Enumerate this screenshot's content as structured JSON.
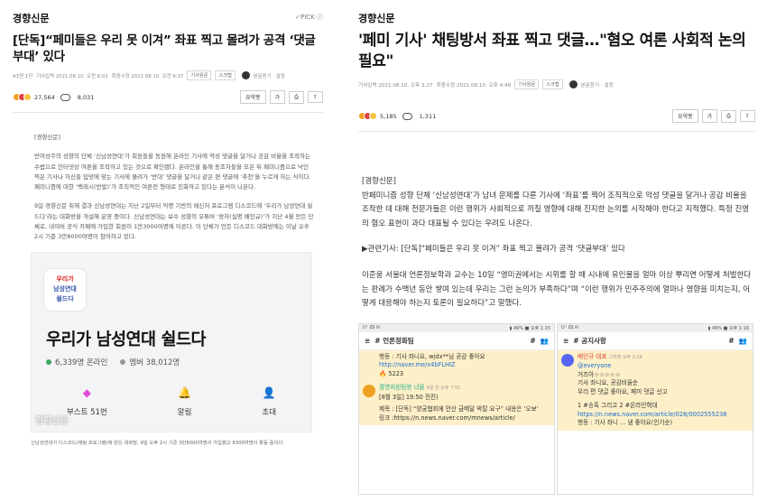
{
  "left": {
    "brand": "경향신문",
    "pick": "✓PICK ⓘ",
    "title": "[단독]“페미들은 우리 못 이겨” 좌표 찍고 몰려가 공격 ‘댓글부대’ 있다",
    "meta": {
      "page": "A1면 1단",
      "published": "기사입력 2021.08.10. 오전 6:01",
      "modified": "최종수정 2021.08.10. 오전 9:37",
      "chip1": "기사원문",
      "chip2": "스크랩",
      "audio": "본문듣기 · 설정"
    },
    "reactions": {
      "likes": "27,564",
      "comments": "8,031"
    },
    "tools": {
      "summary": "요약봇",
      "font": "가"
    },
    "body": [
      "[경향신문]",
      "반여성주의 성향의 단체 ‘신남성연대’가 회원들을 동원해 온라인 기사에 악성 댓글을 달거나 공감 비율을 조작하는 수법으로 인터넷상 여론을 조작하고 있는 것으로 확인됐다. 온라인을 통해 동조자들을 모은 뒤 페미니즘으로 낙인 찍은 기사나 자신들 입맛에 맞는 기사에 몰려가 ‘반대’ 댓글을 달거나 같은 편 댓글에 ‘추천’을 누르게 하는 식이다. 페미니즘에 대한 ‘백래시(반발)’가 조직적인 여론전 형태로 진화하고 있다는 분석이 나온다.",
      "9일 경향신문 취재 결과 신남성연대는 지난 2일부터 익명 기반의 메신저 프로그램 디스코드에 ‘우리가 남성연대 쉴드다’라는 대화방을 개설해 운영 중이다. 신남성연대는 보수 성향의 유튜버 ‘왕자(실명 배인규)’가 지난 4월 만든 단체로, 네이버 공식 카페에 가입한 회원이 1만3000여명에 이른다. 이 단체가 만든 디스코드 대화방에는 이날 오후 2시 기준 3만8000여명이 참여하고 있다."
    ],
    "card": {
      "logo_top": "우리가",
      "logo_mid": "남성연대",
      "logo_bot": "쉴드다",
      "name": "우리가 남성연대 쉴드다",
      "online": "6,339명 온라인",
      "members": "멤버 38,012명",
      "boost": "부스트 51번",
      "alarm": "알림",
      "invite": "초대",
      "watermark": "경향신문"
    },
    "caption": "신남성연대가 디스코드(채팅 프로그램)에 만든 대화방. 9일 오후 2시 기준 3만8000여명이 가입했고 6300여명이 활동 중이다."
  },
  "right": {
    "brand": "경향신문",
    "title": "'페미 기사' 채팅방서 좌표 찍고 댓글…\"혐오 여론 사회적 논의 필요\"",
    "meta": {
      "published": "기사입력 2021.08.10. 오후 3:27",
      "modified": "최종수정 2021.08.10. 오후 4:46",
      "chip1": "기사원문",
      "chip2": "스크랩",
      "audio": "본문듣기 · 설정"
    },
    "reactions": {
      "likes": "5,185",
      "comments": "1,311"
    },
    "tools": {
      "summary": "요약봇",
      "font": "가"
    },
    "body": [
      "[경향신문]",
      "반페미니즘 성향 단체 ‘신남성연대’가 남녀 문제를 다룬 기사에 ‘좌표’를 찍어 조직적으로 악성 댓글을 달거나 공감 비율을 조작한 데 대해 전문가들은 이런 행위가 사회적으로 끼칠 영향에 대해 진지한 논의를 시작해야 한다고 지적했다. 특정 진영의 혐오 표현이 과다 대표될 수 있다는 우려도 나온다.",
      "▶관련기사: [단독]“페미들은 우리 못 이겨” 좌표 찍고 몰려가 공격 ‘댓글부대’ 있다",
      "이준웅 서울대 언론정보학과 교수는 10일 “영미권에서는 시위를 할 때 시내에 유인물을 얼마 이상 뿌리면 어떻게 처벌한다는 판례가 수백년 동안 쌓여 있는데 우리는 그런 논의가 부족하다”며 “이런 행위가 민주주의에 얼마나 영향을 미치는지, 어떻게 대응해야 하는지 토론이 필요하다”고 말했다."
    ],
    "phone1": {
      "status": "U⁺ 🖾 ✉",
      "clock": "▮ 49% ■ 오후 1:15",
      "channel": "# 언론정화팀",
      "m1a": "행동 : 기사 좌니요, wjdx**님 공감 좋아요",
      "m1link": "http://naver.me/x4bFLHIZ",
      "m1count": "5223",
      "m2name": "경명지원팀왕 너물",
      "m2time": "6일 전 오후 7:51",
      "m2a": "[8월 3일] 19:50 전진)",
      "m2b": "제목 : [단독] “양궁협회에 안산 금메달 박탈 요구” 내용은 ‘오보’",
      "m2c": "링크 :https://n.news.naver.com/mnews/article/"
    },
    "phone2": {
      "status": "U⁺ 🖾 ✉",
      "clock": "▮ 49% ■ 오후 1:16",
      "channel": "# 공지사항",
      "m1name": "배인규 대표",
      "m1time": "그저께 오후 2:24",
      "m1a": "@everyone",
      "m1b": "거즈아☆☆☆☆☆",
      "m1c": "기사 좌니요, 공감비율순",
      "m1d": "우리 편 댓글 좋아요, 페미 댓글 신고",
      "m2a": "1 #송혹 그리고 2 #온라인혁대",
      "m2link": "https://n.news.naver.com/article/028/0002555238",
      "m2b": "행동 : 기사 좌니 ... 냄 좋아요(인기순)"
    }
  }
}
